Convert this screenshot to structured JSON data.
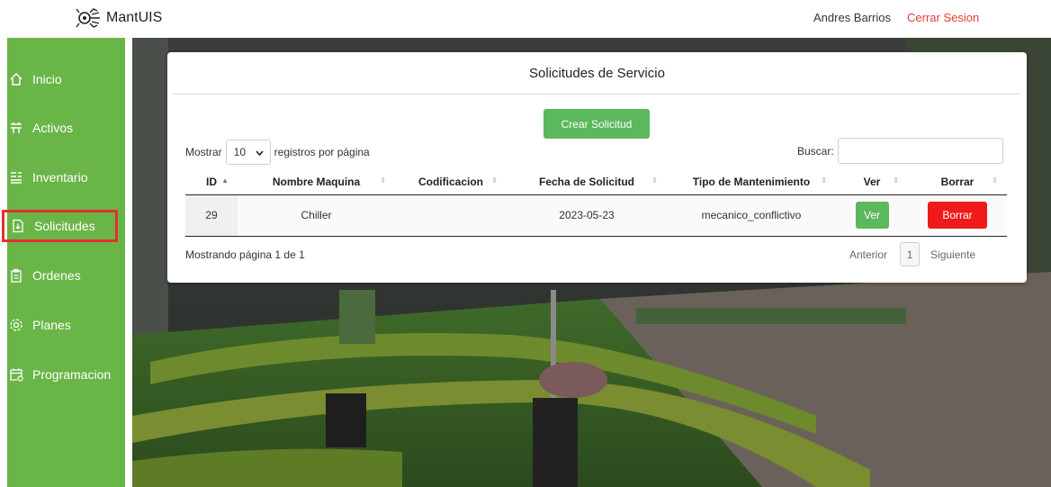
{
  "app": {
    "name": "MantUIS",
    "logo_icon": "robot-spider-logo"
  },
  "header": {
    "user_name": "Andres Barrios",
    "logout_label": "Cerrar Sesion",
    "logout_color": "#e53935"
  },
  "colors": {
    "sidebar": "#6ab548",
    "accent_green": "#5cb85c",
    "danger_red": "#ef1a1a",
    "active_outline": "#e53030"
  },
  "sidebar": {
    "items": [
      {
        "label": "Inicio",
        "icon": "home-icon"
      },
      {
        "label": "Activos",
        "icon": "assets-icon"
      },
      {
        "label": "Inventario",
        "icon": "inventory-icon"
      },
      {
        "label": "Solicitudes",
        "icon": "document-icon",
        "active": true
      },
      {
        "label": "Ordenes",
        "icon": "clipboard-icon"
      },
      {
        "label": "Planes",
        "icon": "gear-icon"
      },
      {
        "label": "Programacion",
        "icon": "calendar-icon"
      }
    ]
  },
  "card": {
    "title": "Solicitudes de Servicio",
    "create_button": "Crear Solicitud",
    "length": {
      "prefix": "Mostrar",
      "value": "10",
      "suffix": "registros por página"
    },
    "search": {
      "label": "Buscar:",
      "value": ""
    },
    "table": {
      "columns": [
        "ID",
        "Nombre Maquina",
        "Codificacion",
        "Fecha de Solicitud",
        "Tipo de Mantenimiento",
        "Ver",
        "Borrar"
      ],
      "sorted_column": "ID",
      "rows": [
        {
          "id": "29",
          "nombre": "Chiller",
          "codificacion": "",
          "fecha": "2023-05-23",
          "tipo": "mecanico_conflictivo",
          "ver": "Ver",
          "borrar": "Borrar"
        }
      ]
    },
    "info": "Mostrando página 1 de 1",
    "pager": {
      "prev": "Anterior",
      "current": "1",
      "next": "Siguiente"
    }
  }
}
